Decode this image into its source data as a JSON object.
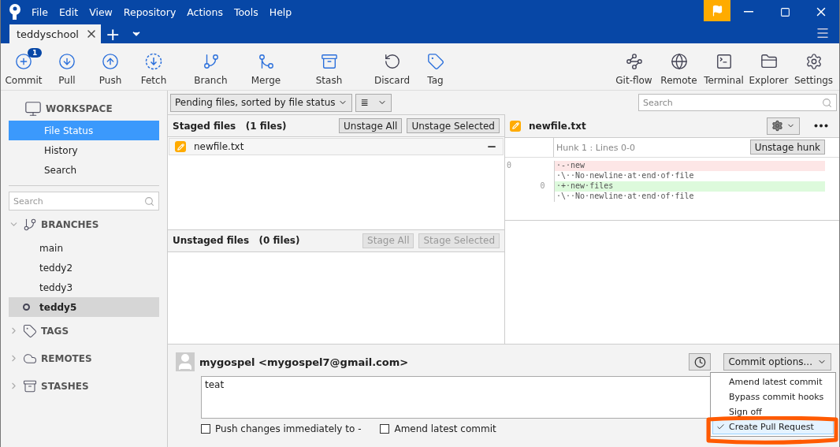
{
  "titlebar": {
    "menu": [
      "File",
      "Edit",
      "View",
      "Repository",
      "Actions",
      "Tools",
      "Help"
    ],
    "tabs": [
      {
        "label": "teddyschool",
        "selected": true
      }
    ],
    "add_tab": "+"
  },
  "toolbar": {
    "left": [
      {
        "kind": "commit",
        "label": "Commit",
        "badge": "1"
      },
      {
        "kind": "pull",
        "label": "Pull"
      },
      {
        "kind": "push",
        "label": "Push"
      },
      {
        "kind": "fetch",
        "label": "Fetch"
      },
      {
        "kind": "branch",
        "label": "Branch"
      },
      {
        "kind": "merge",
        "label": "Merge"
      },
      {
        "kind": "stash",
        "label": "Stash"
      },
      {
        "kind": "discard",
        "label": "Discard"
      },
      {
        "kind": "tag",
        "label": "Tag"
      }
    ],
    "right": [
      {
        "kind": "gitflow",
        "label": "Git-flow"
      },
      {
        "kind": "remote",
        "label": "Remote"
      },
      {
        "kind": "terminal",
        "label": "Terminal"
      },
      {
        "kind": "explorer",
        "label": "Explorer"
      },
      {
        "kind": "settings",
        "label": "Settings"
      }
    ]
  },
  "sidebar": {
    "workspace": {
      "label": "WORKSPACE",
      "items": [
        {
          "label": "File Status",
          "selected": true
        },
        {
          "label": "History",
          "selected": false
        },
        {
          "label": "Search",
          "selected": false
        }
      ]
    },
    "search": {
      "placeholder": "Search"
    },
    "sections": [
      {
        "kind": "branch",
        "label": "BRANCHES",
        "expanded": true,
        "items": [
          {
            "label": "main",
            "selected": false
          },
          {
            "label": "teddy2",
            "selected": false
          },
          {
            "label": "teddy3",
            "selected": false
          },
          {
            "label": "teddy5",
            "selected": true
          }
        ]
      },
      {
        "kind": "tag",
        "label": "TAGS",
        "expanded": false
      },
      {
        "kind": "cloud",
        "label": "REMOTES",
        "expanded": false
      },
      {
        "kind": "stash",
        "label": "STASHES",
        "expanded": false
      }
    ]
  },
  "filter": {
    "sort": "Pending files, sorted by file status",
    "view_icon": "≣"
  },
  "search": {
    "placeholder": "Search"
  },
  "staged": {
    "title": "Staged files",
    "count": "(1 files)",
    "buttons": [
      {
        "label": "Unstage All",
        "disabled": false
      },
      {
        "label": "Unstage Selected",
        "disabled": false
      }
    ],
    "files": [
      {
        "name": "newfile.txt"
      }
    ]
  },
  "unstaged": {
    "title": "Unstaged files",
    "count": "(0 files)",
    "buttons": [
      {
        "label": "Stage All",
        "disabled": true
      },
      {
        "label": "Stage Selected",
        "disabled": true
      }
    ]
  },
  "diff": {
    "file": "newfile.txt",
    "hunk": "Hunk 1 : Lines 0-0",
    "hunk_button": "Unstage hunk",
    "lines": [
      {
        "kind": "removed",
        "old": "0",
        "text": "·-·new"
      },
      {
        "kind": "context",
        "text": "·\\··No·newline·at·end·of·file"
      },
      {
        "kind": "added",
        "new": "0",
        "text": "·+·new·files"
      },
      {
        "kind": "context",
        "text": "·\\··No·newline·at·end·of·file"
      }
    ]
  },
  "commit": {
    "author": "mygospel <mygospel7@gmail.com>",
    "message": "teat",
    "options_button": "Commit options...",
    "options_menu": [
      {
        "label": "Amend latest commit",
        "checked": false
      },
      {
        "label": "Bypass commit hooks",
        "checked": false
      },
      {
        "label": "Sign off",
        "checked": false
      },
      {
        "label": "Create Pull Request",
        "checked": true
      }
    ],
    "checkboxes": [
      {
        "label": "Push changes immediately to -",
        "checked": false
      },
      {
        "label": "Amend latest commit",
        "checked": false
      }
    ]
  }
}
